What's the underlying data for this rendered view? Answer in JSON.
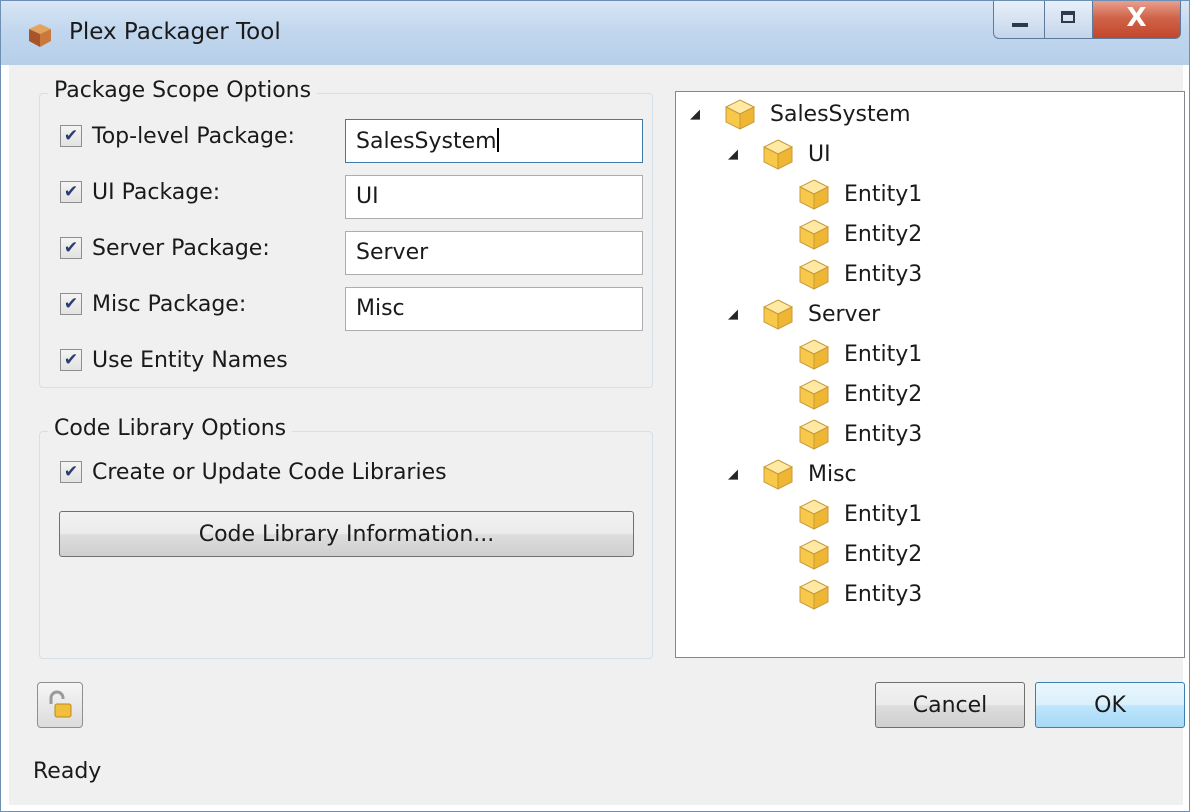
{
  "window": {
    "title": "Plex Packager Tool",
    "close_glyph": "X"
  },
  "package_scope": {
    "title": "Package Scope Options",
    "top_level": {
      "label": "Top-level Package:",
      "checked": true,
      "value": "SalesSystem"
    },
    "ui": {
      "label": "UI Package:",
      "checked": true,
      "value": "UI"
    },
    "server": {
      "label": "Server Package:",
      "checked": true,
      "value": "Server"
    },
    "misc": {
      "label": "Misc Package:",
      "checked": true,
      "value": "Misc"
    },
    "use_entity_names": {
      "label": "Use Entity Names",
      "checked": true
    }
  },
  "code_library": {
    "title": "Code Library Options",
    "create_update": {
      "label": "Create or Update Code Libraries",
      "checked": true
    },
    "info_button": "Code Library Information..."
  },
  "tree": {
    "root": "SalesSystem",
    "children": [
      {
        "label": "UI",
        "children": [
          "Entity1",
          "Entity2",
          "Entity3"
        ]
      },
      {
        "label": "Server",
        "children": [
          "Entity1",
          "Entity2",
          "Entity3"
        ]
      },
      {
        "label": "Misc",
        "children": [
          "Entity1",
          "Entity2",
          "Entity3"
        ]
      }
    ],
    "expanded_glyph": "◢",
    "icon": "package-cube-icon"
  },
  "buttons": {
    "cancel": "Cancel",
    "ok": "OK"
  },
  "status": {
    "text": "Ready"
  },
  "icons": {
    "app": "package-box-icon",
    "lock": "unlocked-padlock-icon",
    "check": "✔"
  },
  "colors": {
    "titlebar": "#c2d7ee",
    "client": "#f0f0f0",
    "close_button": "#c2462a",
    "cube_fill": "#f7c84a",
    "cube_top": "#ffe9a3"
  }
}
